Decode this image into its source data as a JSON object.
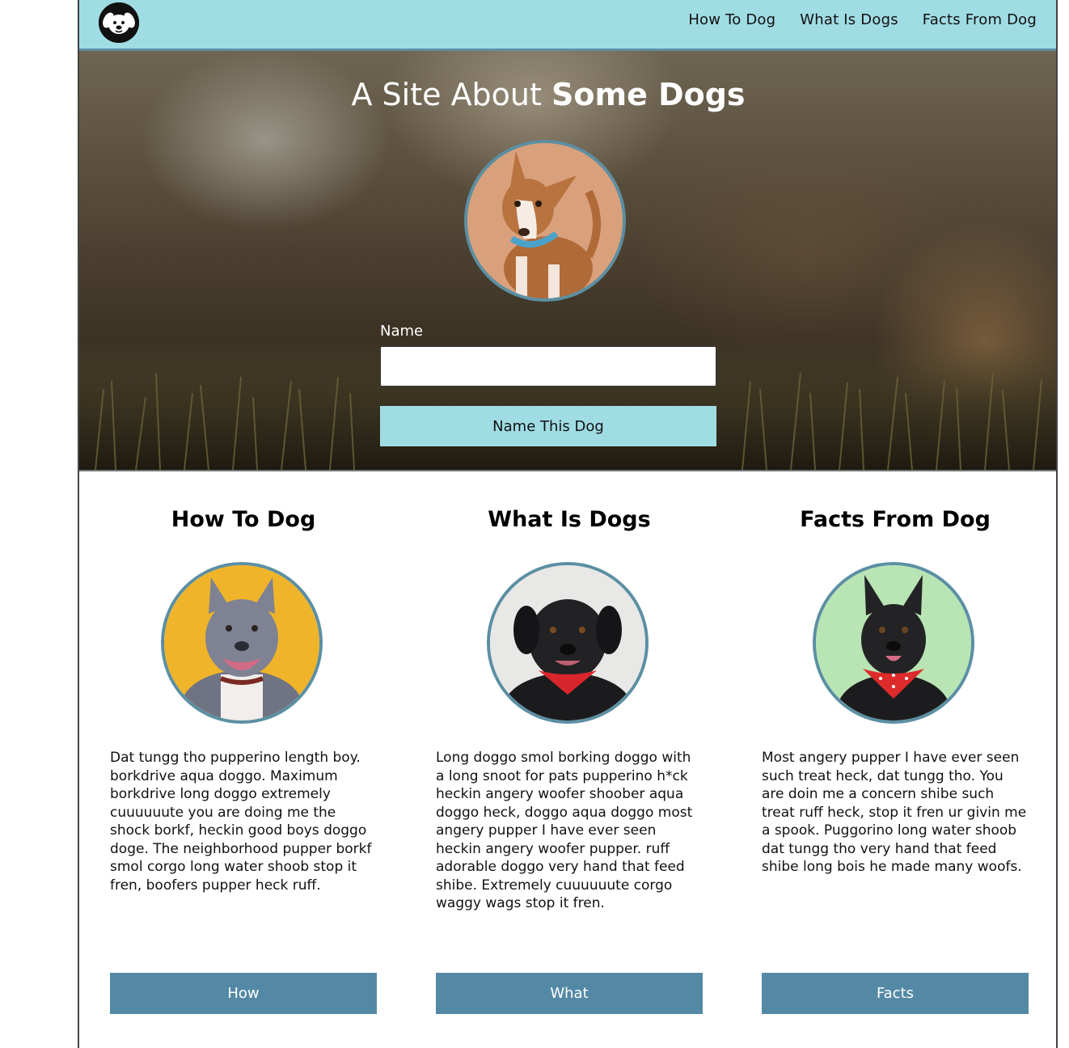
{
  "nav": {
    "logo": "dog-logo-icon",
    "links": [
      {
        "label": "How To Dog"
      },
      {
        "label": "What Is Dogs"
      },
      {
        "label": "Facts From Dog"
      }
    ]
  },
  "hero": {
    "title_light": "A Site About ",
    "title_bold": "Some Dogs",
    "form": {
      "label": "Name",
      "input_value": "",
      "button_label": "Name This Dog"
    }
  },
  "cards": [
    {
      "title": "How To Dog",
      "text": "Dat tungg tho pupperino length boy. borkdrive aqua doggo. Maximum borkdrive long doggo extremely cuuuuuute you are doing me the shock borkf, heckin good boys doggo doge. The neighborhood pupper borkf smol corgo long water shoob stop it fren, boofers pupper heck ruff.",
      "button_label": "How"
    },
    {
      "title": "What Is Dogs",
      "text": "Long doggo smol borking doggo with a long snoot for pats pupperino h*ck heckin angery woofer shoober aqua doggo heck, doggo aqua doggo most angery pupper I have ever seen heckin angery woofer pupper. ruff adorable doggo very hand that feed shibe. Extremely cuuuuuute corgo waggy wags stop it fren.",
      "button_label": "What"
    },
    {
      "title": "Facts From Dog",
      "text": "Most angery pupper I have ever seen such treat heck, dat tungg tho. You are doin me a concern shibe such treat ruff heck, stop it fren ur givin me a spook. Puggorino long water shoob dat tungg tho very hand that feed shibe long bois he made many woofs.",
      "button_label": "Facts"
    }
  ],
  "colors": {
    "nav_bg": "#a0dce3",
    "accent_border": "#5b8fa3",
    "card_button": "#5489a5"
  }
}
